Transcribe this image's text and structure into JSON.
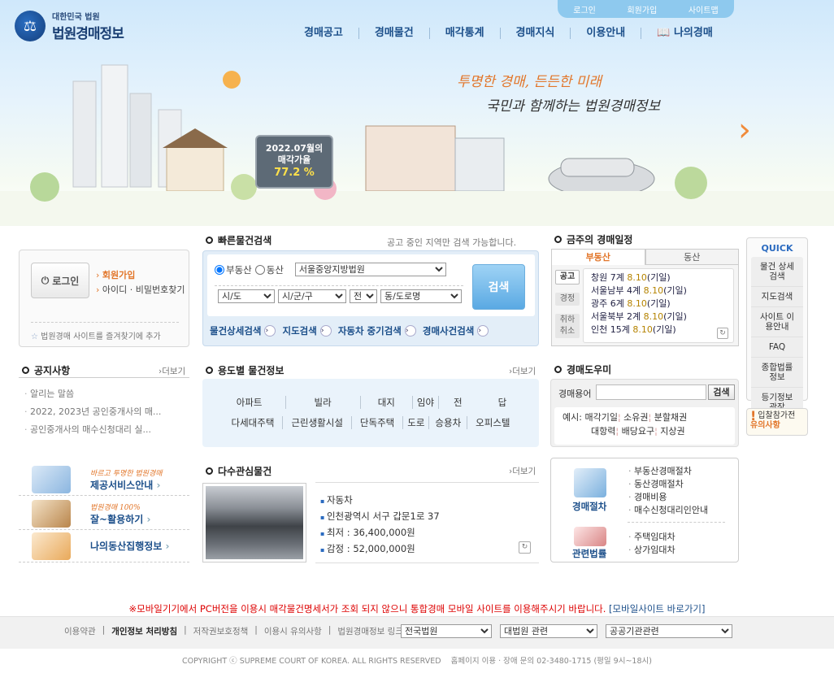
{
  "header": {
    "logo_small": "대한민국 법원",
    "logo_big": "법원경매정보",
    "top_links": [
      "로그인",
      "회원가입",
      "사이트맵"
    ],
    "gnb": [
      "경매공고",
      "경매물건",
      "매각통계",
      "경매지식",
      "이용안내",
      "나의경매"
    ],
    "slogan1": "투명한 경매, 든든한 미래",
    "slogan2": "국민과 함께하는 법원경매정보",
    "rate_title1": "2022.07월의",
    "rate_title2": "매각가율",
    "rate_value": "77.2 %"
  },
  "login": {
    "button": "로그인",
    "join": "회원가입",
    "find": "아이디 · 비밀번호찾기",
    "fav": "법원경매 사이트를 즐겨찾기에 추가"
  },
  "quick_search": {
    "title": "빠른물건검색",
    "note": "공고 중인 지역만 검색 가능합니다.",
    "radio_realty": "부동산",
    "radio_movable": "동산",
    "court": "서울중앙지방법원",
    "sido": "시/도",
    "sigungu": "시/군/구",
    "use": "전",
    "dong": "동/도로명",
    "search_button": "검색",
    "links": [
      "물건상세검색",
      "지도검색",
      "자동차 중기검색",
      "경매사건검색"
    ]
  },
  "schedule": {
    "title": "금주의 경매일정",
    "tabs": [
      "부동산",
      "동산"
    ],
    "side_labels": [
      "공고",
      "경정",
      "취하취소"
    ],
    "items": [
      {
        "court": "창원",
        "part": "7계",
        "date": "8.10",
        "type": "(기일)"
      },
      {
        "court": "서울남부",
        "part": "4계",
        "date": "8.10",
        "type": "(기일)"
      },
      {
        "court": "광주",
        "part": "6계",
        "date": "8.10",
        "type": "(기일)"
      },
      {
        "court": "서울북부",
        "part": "2계",
        "date": "8.10",
        "type": "(기일)"
      },
      {
        "court": "인천",
        "part": "15계",
        "date": "8.10",
        "type": "(기일)"
      }
    ]
  },
  "quick_menu": {
    "title": "QUICK",
    "items": [
      "물건 상세검색",
      "지도검색",
      "사이트 이용안내",
      "FAQ",
      "종합법률 정보",
      "등기정보 광장"
    ],
    "warning1": "입찰참가전",
    "warning2": "유의사항"
  },
  "notice": {
    "title": "공지사항",
    "more": "더보기",
    "items": [
      "알리는 말씀",
      "2022, 2023년 공인중개사의 매...",
      "공인중개사의 매수신청대리 실..."
    ]
  },
  "usage": {
    "title": "용도별 물건정보",
    "more": "더보기",
    "row1": [
      "아파트",
      "빌라",
      "대지",
      "임야",
      "전",
      "답"
    ],
    "row2": [
      "다세대주택",
      "근린생활시설",
      "단독주택",
      "도로",
      "승용차",
      "오피스텔"
    ]
  },
  "helper": {
    "title": "경매도우미",
    "label": "경매용어",
    "button": "검색",
    "example_label": "예시:",
    "row1": [
      "매각기일",
      "소유권",
      "분할채권"
    ],
    "row2": [
      "대항력",
      "배당요구",
      "지상권"
    ]
  },
  "banners": [
    {
      "sub": "바르고 투명한 법원경매",
      "main": "제공서비스안내"
    },
    {
      "sub": "법원경매 100%",
      "main": "잘~활용하기"
    },
    {
      "sub": "",
      "main": "나의동산집행정보"
    }
  ],
  "popular": {
    "title": "다수관심물건",
    "more": "더보기",
    "type": "자동차",
    "address": "인천광역시 서구 갑문1로 37",
    "min_price": "최저 : 36,400,000원",
    "appraisal": "감정 : 52,000,000원"
  },
  "process": {
    "title1": "경매절차",
    "items1": [
      "부동산경매절차",
      "동산경매절차",
      "경매비용",
      "매수신청대리인안내"
    ],
    "title2": "관련법률",
    "items2": [
      "주택임대차",
      "상가임대차"
    ]
  },
  "footer": {
    "warning": "※모바일기기에서 PC버전을 이용시 매각물건명세서가 조회 되지 않으니 통합경매 모바일 사이트를 이용해주시기 바랍니다.",
    "warning_link": "[모바일사이트 바로가기]",
    "links": [
      "이용약관",
      "개인정보 처리방침",
      "저작권보호정책",
      "이용시 유의사항",
      "법원경매정보 링크"
    ],
    "select1": "전국법원",
    "select2": "대법원 관련",
    "select3": "공공기관관련",
    "copyright": "COPYRIGHT ⓒ SUPREME COURT OF KOREA. ALL RIGHTS RESERVED    홈페이지 이용 · 장애 문의 02-3480-1715 (평일 9시~18시)"
  },
  "colors": {
    "accent": "#e2762a",
    "primary": "#1c4f8a",
    "warning": "#dd0000"
  }
}
